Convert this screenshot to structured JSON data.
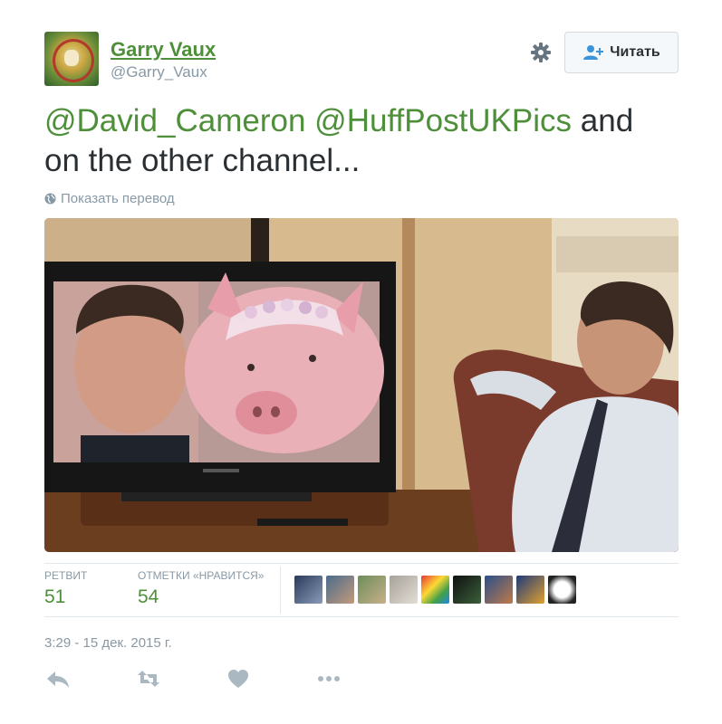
{
  "author": {
    "display_name": "Garry Vaux",
    "handle": "@Garry_Vaux"
  },
  "follow_button": {
    "label": "Читать"
  },
  "tweet": {
    "mention_1": "@David_Cameron",
    "mention_2": "@HuffPostUKPics",
    "text_rest_1": " and",
    "text_rest_2": "on the other channel..."
  },
  "translate_link": "Показать перевод",
  "stats": {
    "retweets_label": "РЕТВИТ",
    "retweets_value": "51",
    "likes_label": "ОТМЕТКИ «НРАВИТСЯ»",
    "likes_value": "54"
  },
  "likers_count_shown": 9,
  "timestamp": "3:29 - 15 дек. 2015 г.",
  "actions": [
    "reply-icon",
    "retweet-icon",
    "like-icon",
    "more-icon"
  ],
  "colors": {
    "link_green": "#4e8f3a",
    "muted": "#8899a6",
    "text": "#292f33",
    "divider": "#e1e8ed"
  }
}
